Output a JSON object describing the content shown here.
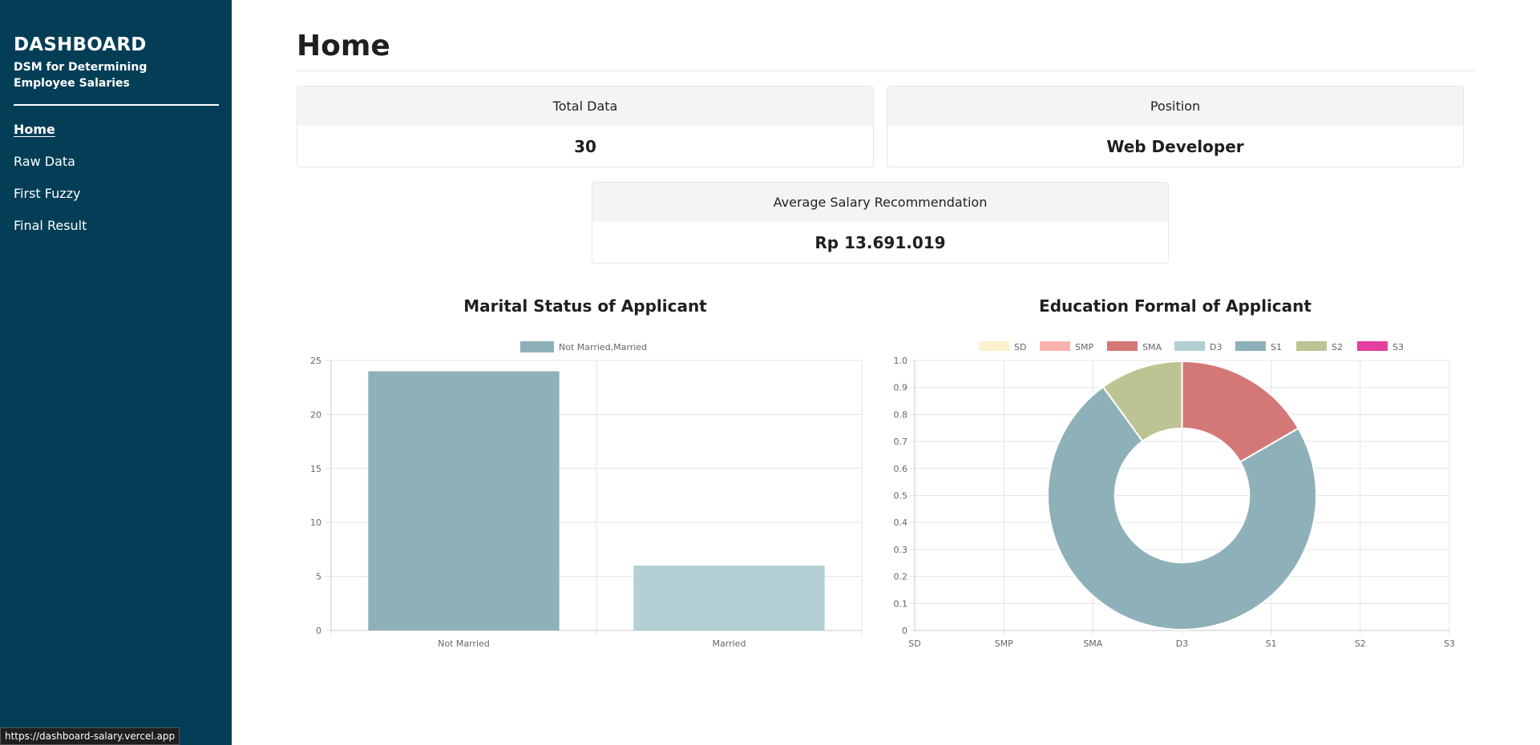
{
  "sidebar": {
    "title": "DASHBOARD",
    "subtitle": "DSM for Determining Employee Salaries",
    "nav": [
      {
        "label": "Home",
        "active": true
      },
      {
        "label": "Raw Data",
        "active": false
      },
      {
        "label": "First Fuzzy",
        "active": false
      },
      {
        "label": "Final Result",
        "active": false
      }
    ]
  },
  "status_bar": {
    "url": "https://dashboard-salary.vercel.app"
  },
  "page": {
    "title": "Home"
  },
  "cards": {
    "total_data": {
      "header": "Total Data",
      "value": "30"
    },
    "position": {
      "header": "Position",
      "value": "Web Developer"
    },
    "avg_salary": {
      "header": "Average Salary Recommendation",
      "value": "Rp 13.691.019"
    }
  },
  "colors": {
    "sidebar_bg": "#033e56",
    "bar_not_married": "#8eb0b9",
    "bar_married": "#b2cfd4"
  },
  "chart_data": [
    {
      "type": "bar",
      "title": "Marital Status of Applicant",
      "legend": [
        "Not Married,Married"
      ],
      "categories": [
        "Not Married",
        "Married"
      ],
      "values": [
        24,
        6
      ],
      "colors": [
        "#8eb0b9",
        "#b2cfd4"
      ],
      "ylim": [
        0,
        25
      ],
      "yticks": [
        0,
        5,
        10,
        15,
        20,
        25
      ],
      "grid": true,
      "legend_position": "top"
    },
    {
      "type": "pie",
      "title": "Education Formal of Applicant",
      "donut": true,
      "categories": [
        "SD",
        "SMP",
        "SMA",
        "D3",
        "S1",
        "S2",
        "S3"
      ],
      "values": [
        0,
        0,
        5,
        0,
        22,
        3,
        0
      ],
      "colors": [
        "#fdf1cf",
        "#fcb3b0",
        "#d47877",
        "#b2cfd4",
        "#8eb0b9",
        "#bec393",
        "#e43e9f"
      ],
      "yticks": [
        "0",
        "0.1",
        "0.2",
        "0.3",
        "0.4",
        "0.5",
        "0.6",
        "0.7",
        "0.8",
        "0.9",
        "1.0"
      ],
      "grid": true,
      "legend_position": "top"
    }
  ]
}
